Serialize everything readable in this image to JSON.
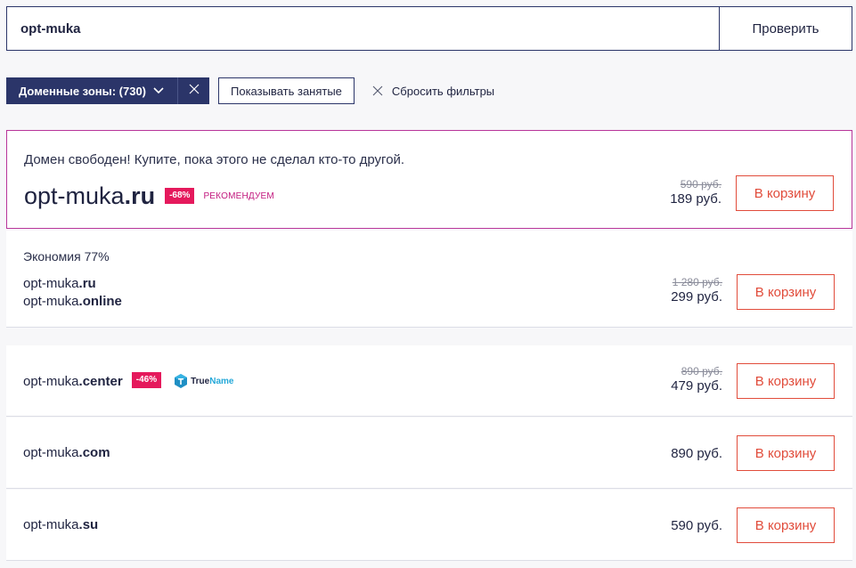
{
  "search": {
    "value": "opt-muka",
    "button_label": "Проверить"
  },
  "filters": {
    "zones_label": "Доменные зоны: (730)",
    "show_taken_label": "Показывать занятые",
    "reset_label": "Сбросить фильтры"
  },
  "main_offer": {
    "headline": "Домен свободен! Купите, пока этого не сделал кто-то другой.",
    "domain_name": "opt-muka",
    "domain_tld": ".ru",
    "discount": "-68%",
    "recommend": "РЕКОМЕНДУЕМ",
    "old_price": "590 руб.",
    "new_price": "189 руб.",
    "cart_label": "В корзину"
  },
  "combo_offer": {
    "savings": "Экономия 77%",
    "domains": [
      {
        "name": "opt-muka",
        "tld": ".ru"
      },
      {
        "name": "opt-muka",
        "tld": ".online"
      }
    ],
    "old_price": "1 280 руб.",
    "new_price": "299 руб.",
    "cart_label": "В корзину"
  },
  "rows": [
    {
      "name": "opt-muka",
      "tld": ".center",
      "discount": "-46%",
      "brand_a": "True",
      "brand_b": "Name",
      "old_price": "890 руб.",
      "new_price": "479 руб.",
      "cart_label": "В корзину"
    },
    {
      "name": "opt-muka",
      "tld": ".com",
      "new_price": "890 руб.",
      "cart_label": "В корзину"
    },
    {
      "name": "opt-muka",
      "tld": ".su",
      "new_price": "590 руб.",
      "cart_label": "В корзину"
    }
  ],
  "colors": {
    "navy": "#2b3569",
    "accent_red": "#e14c3b",
    "discount_pink": "#e5195c",
    "highlight_border": "#b8359a"
  }
}
